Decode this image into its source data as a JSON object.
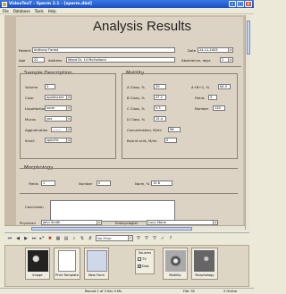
{
  "window": {
    "title": "VideoTesT - Sperm 2.1 - [sperm.dbd]"
  },
  "menu": [
    "File",
    "Database",
    "Tools",
    "Help"
  ],
  "form": {
    "title": "Analysis Results",
    "patient_label": "Patient",
    "patient_value": "Anthony Forest",
    "date_label": "Date",
    "date_value": "24.11.2003",
    "age_label": "Age",
    "age_value": "22",
    "address_label": "Address",
    "address_value": "Wood Dr. 14 Mulholland",
    "abstinence_label": "Abstinence, days",
    "abstinence_value": "2",
    "sample": {
      "title": "Sample Description",
      "volume_label": "Volume",
      "volume_value": "3",
      "color_label": "Color",
      "color_value": "opalescent",
      "liquefaction_label": "Liquefaction",
      "liquefaction_value": "norm",
      "mucus_label": "Mucus",
      "mucus_value": "yes",
      "agglutination_label": "Agglutination",
      "agglutination_value": "-------",
      "smell_label": "Smell",
      "smell_value": "specific"
    },
    "motility": {
      "title": "Motility",
      "a_label": "A Class, %",
      "a_value": "20",
      "ab_label": "A+B+C, %",
      "ab_value": "64.5",
      "b_label": "B Class, %",
      "b_value": "47.1",
      "fields_label": "Fields",
      "fields_value": "3",
      "c_label": "C Class, %",
      "c_value": "5.5",
      "number_label": "Number",
      "number_value": "130",
      "d_label": "D Class, %",
      "d_value": "15.4",
      "conc_label": "Concentration, M/ml",
      "conc_value": "98",
      "round_label": "Round cells, M/ml",
      "round_value": "0"
    },
    "morphology": {
      "title": "Morphology",
      "fields_label": "Fields",
      "fields_value": "1",
      "number_label": "Number",
      "number_value": "0",
      "norm_label": "Norm, %",
      "norm_value": "15.6"
    },
    "conclusion_label": "Conclusion",
    "conclusion_value": "",
    "physician_label": "Physician",
    "physician_value": "John Smith",
    "embryologist_label": "Embryologist",
    "embryologist_value": "Lucy Stone"
  },
  "toolbar": {
    "filter_value": "No Filter"
  },
  "panel": {
    "image_label": "Image",
    "print_label": "Print Template",
    "new_label": "New Form",
    "sources_title": "Sources",
    "tv_label": "TV",
    "disk_label": "Disk",
    "disk_checked": "✔",
    "motility_label": "Motility",
    "morphology_label": "Morphology"
  },
  "status": {
    "record": "Record 1 of 3  Sec 0 Ms",
    "file": "File: 32",
    "name": "2 Online"
  }
}
